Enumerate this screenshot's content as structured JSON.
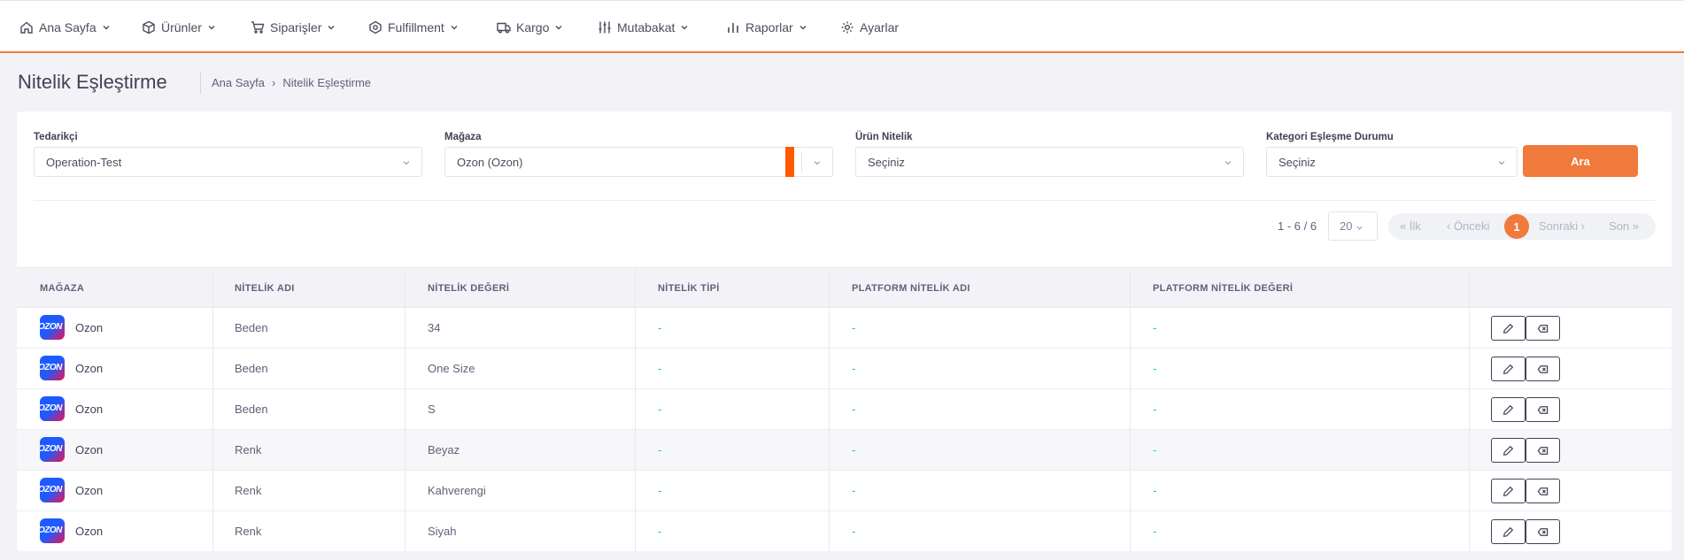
{
  "nav": [
    {
      "label": "Ana Sayfa",
      "icon": "home-icon"
    },
    {
      "label": "Ürünler",
      "icon": "box-icon"
    },
    {
      "label": "Siparişler",
      "icon": "cart-icon"
    },
    {
      "label": "Fulfillment",
      "icon": "gear-box-icon"
    },
    {
      "label": "Kargo",
      "icon": "truck-icon"
    },
    {
      "label": "Mutabakat",
      "icon": "sliders-icon"
    },
    {
      "label": "Raporlar",
      "icon": "bar-chart-icon"
    },
    {
      "label": "Ayarlar",
      "icon": "gear-icon"
    }
  ],
  "page": {
    "title": "Nitelik Eşleştirme",
    "breadcrumb": [
      "Ana Sayfa",
      "Nitelik Eşleştirme"
    ],
    "breadcrumb_separator": "›"
  },
  "filters": {
    "supplier": {
      "label": "Tedarikçi",
      "value": "Operation-Test"
    },
    "store": {
      "label": "Mağaza",
      "value": "Ozon (Ozon)"
    },
    "attribute": {
      "label": "Ürün Nitelik",
      "value": "Seçiniz"
    },
    "category_status": {
      "label": "Kategori Eşleşme Durumu",
      "value": "Seçiniz"
    },
    "search_button": "Ara"
  },
  "pagination": {
    "summary": "1 - 6 / 6",
    "page_size": "20",
    "first": "« İlk",
    "prev": "‹ Önceki",
    "current": "1",
    "next": "Sonraki ›",
    "last": "Son »"
  },
  "table": {
    "headers": [
      "MAĞAZA",
      "NİTELİK ADI",
      "NİTELİK DEĞERİ",
      "NİTELİK TİPİ",
      "PLATFORM NİTELİK ADI",
      "PLATFORM NİTELİK DEĞERİ"
    ],
    "logo_text": "OZON",
    "rows": [
      {
        "store": "Ozon",
        "attr_name": "Beden",
        "attr_value": "34",
        "attr_type": "-",
        "platform_name": "-",
        "platform_value": "-"
      },
      {
        "store": "Ozon",
        "attr_name": "Beden",
        "attr_value": "One Size",
        "attr_type": "-",
        "platform_name": "-",
        "platform_value": "-"
      },
      {
        "store": "Ozon",
        "attr_name": "Beden",
        "attr_value": "S",
        "attr_type": "-",
        "platform_name": "-",
        "platform_value": "-"
      },
      {
        "store": "Ozon",
        "attr_name": "Renk",
        "attr_value": "Beyaz",
        "attr_type": "-",
        "platform_name": "-",
        "platform_value": "-"
      },
      {
        "store": "Ozon",
        "attr_name": "Renk",
        "attr_value": "Kahverengi",
        "attr_type": "-",
        "platform_name": "-",
        "platform_value": "-"
      },
      {
        "store": "Ozon",
        "attr_name": "Renk",
        "attr_value": "Siyah",
        "attr_type": "-",
        "platform_name": "-",
        "platform_value": "-"
      }
    ]
  },
  "colors": {
    "accent": "#f07a3c",
    "store_marker": "#ff5a00",
    "dash": "#1bc5bd",
    "ozon_blue": "#1d5bff",
    "ozon_pink": "#f2124f"
  }
}
